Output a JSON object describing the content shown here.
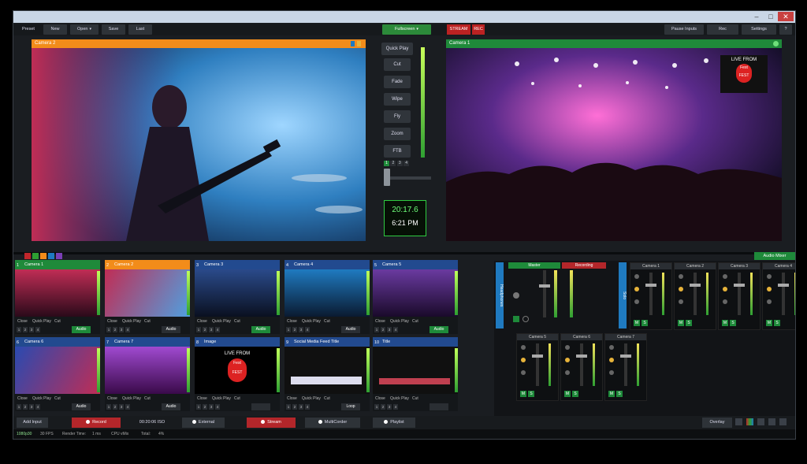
{
  "window": {
    "min_icon": "minimize-icon",
    "max_icon": "maximize-icon",
    "close_icon": "close-icon"
  },
  "toolbar": {
    "preset": "Preset",
    "new": "New",
    "open": "Open",
    "save": "Save",
    "last": "Last",
    "transition_mode": "Fullscreen",
    "stream": "STREAM",
    "rec": "REC",
    "pause_inputs": "Pause Inputs",
    "rec2": "Rec",
    "settings": "Settings",
    "more": "?"
  },
  "preview": {
    "title": "Camera 2",
    "border_color": "#f28c1a"
  },
  "output": {
    "title": "Camera 1",
    "border_color": "#1f8a3a",
    "live_badge": "LIVE FROM",
    "fest_badge": "Fest",
    "fest_sub": "FEST"
  },
  "transitions": {
    "quick_play": "Quick Play",
    "cut": "Cut",
    "fade": "Fade",
    "wipe": "Wipe",
    "fly": "Fly",
    "zoom": "Zoom",
    "ftb": "FTB"
  },
  "transition_numbers": [
    "1",
    "2",
    "3",
    "4"
  ],
  "clock": {
    "duration": "20:17.6",
    "time": "6:21 PM"
  },
  "swatches": [
    "#c0262b",
    "#2ea032",
    "#f28c1a",
    "#1f7ac0",
    "#7a3fb5"
  ],
  "audio_mixer_label": "Audio Mixer",
  "tiles": [
    {
      "num": "1",
      "name": "Camera 1",
      "head": "#1f8a3a",
      "close": "Close",
      "quick": "Quick Play",
      "cut": "Cut",
      "audio": "Audio",
      "audio_on": true
    },
    {
      "num": "2",
      "name": "Camera 2",
      "head": "#f28c1a",
      "close": "Close",
      "quick": "Quick Play",
      "cut": "Cut",
      "audio": "Audio",
      "audio_on": false
    },
    {
      "num": "3",
      "name": "Camera 3",
      "head": "#224a8f",
      "close": "Close",
      "quick": "Quick Play",
      "cut": "Cut",
      "audio": "Audio",
      "audio_on": true
    },
    {
      "num": "4",
      "name": "Camera 4",
      "head": "#224a8f",
      "close": "Close",
      "quick": "Quick Play",
      "cut": "Cut",
      "audio": "Audio",
      "audio_on": false
    },
    {
      "num": "5",
      "name": "Camera 5",
      "head": "#224a8f",
      "close": "Close",
      "quick": "Quick Play",
      "cut": "Cut",
      "audio": "Audio",
      "audio_on": true
    },
    {
      "num": "6",
      "name": "Camera 6",
      "head": "#224a8f",
      "close": "Close",
      "quick": "Quick Play",
      "cut": "Cut",
      "audio": "Audio",
      "audio_on": false
    },
    {
      "num": "7",
      "name": "Camera 7",
      "head": "#224a8f",
      "close": "Close",
      "quick": "Quick Play",
      "cut": "Cut",
      "audio": "Audio",
      "audio_on": false
    },
    {
      "num": "8",
      "name": "Image",
      "head": "#224a8f",
      "close": "Close",
      "quick": "Quick Play",
      "cut": "Cut",
      "audio": "",
      "audio_on": false
    },
    {
      "num": "9",
      "name": "Social Media Feed Title",
      "head": "#224a8f",
      "close": "Close",
      "quick": "Quick Play",
      "cut": "Cut",
      "audio": "Loop",
      "audio_on": false
    },
    {
      "num": "10",
      "name": "Title",
      "head": "#224a8f",
      "close": "Close",
      "quick": "Quick Play",
      "cut": "Cut",
      "audio": "",
      "audio_on": false
    }
  ],
  "tile_numbers": [
    "1",
    "2",
    "3",
    "4"
  ],
  "image_tile": {
    "live": "LIVE FROM",
    "fest": "Fest",
    "sub": "FEST"
  },
  "mixer": {
    "master": "Master",
    "recording": "Recording",
    "headphones": "Headphones",
    "mute_all": "Solo",
    "bus_left": "Master",
    "bus_right": "Solo",
    "strips": [
      "Camera 1",
      "Camera 2",
      "Camera 3",
      "Camera 4",
      "Camera 5",
      "Camera 6",
      "Camera 7"
    ]
  },
  "bottom": {
    "add_input": "Add Input",
    "record": "Record",
    "rec_time": "00:20:06 ISO",
    "external": "External",
    "stream": "Stream",
    "multicorder": "MultiCorder",
    "playlist": "Playlist",
    "overlay": "Overlay"
  },
  "status": {
    "res": "1080p30",
    "fps": "30 FPS",
    "fps_val": "30",
    "render_label": "Render Time:",
    "render_val": "1 ms",
    "cpu": "CPU vMix",
    "cpu_val": "",
    "total": "Total:",
    "total_val": "4%"
  }
}
